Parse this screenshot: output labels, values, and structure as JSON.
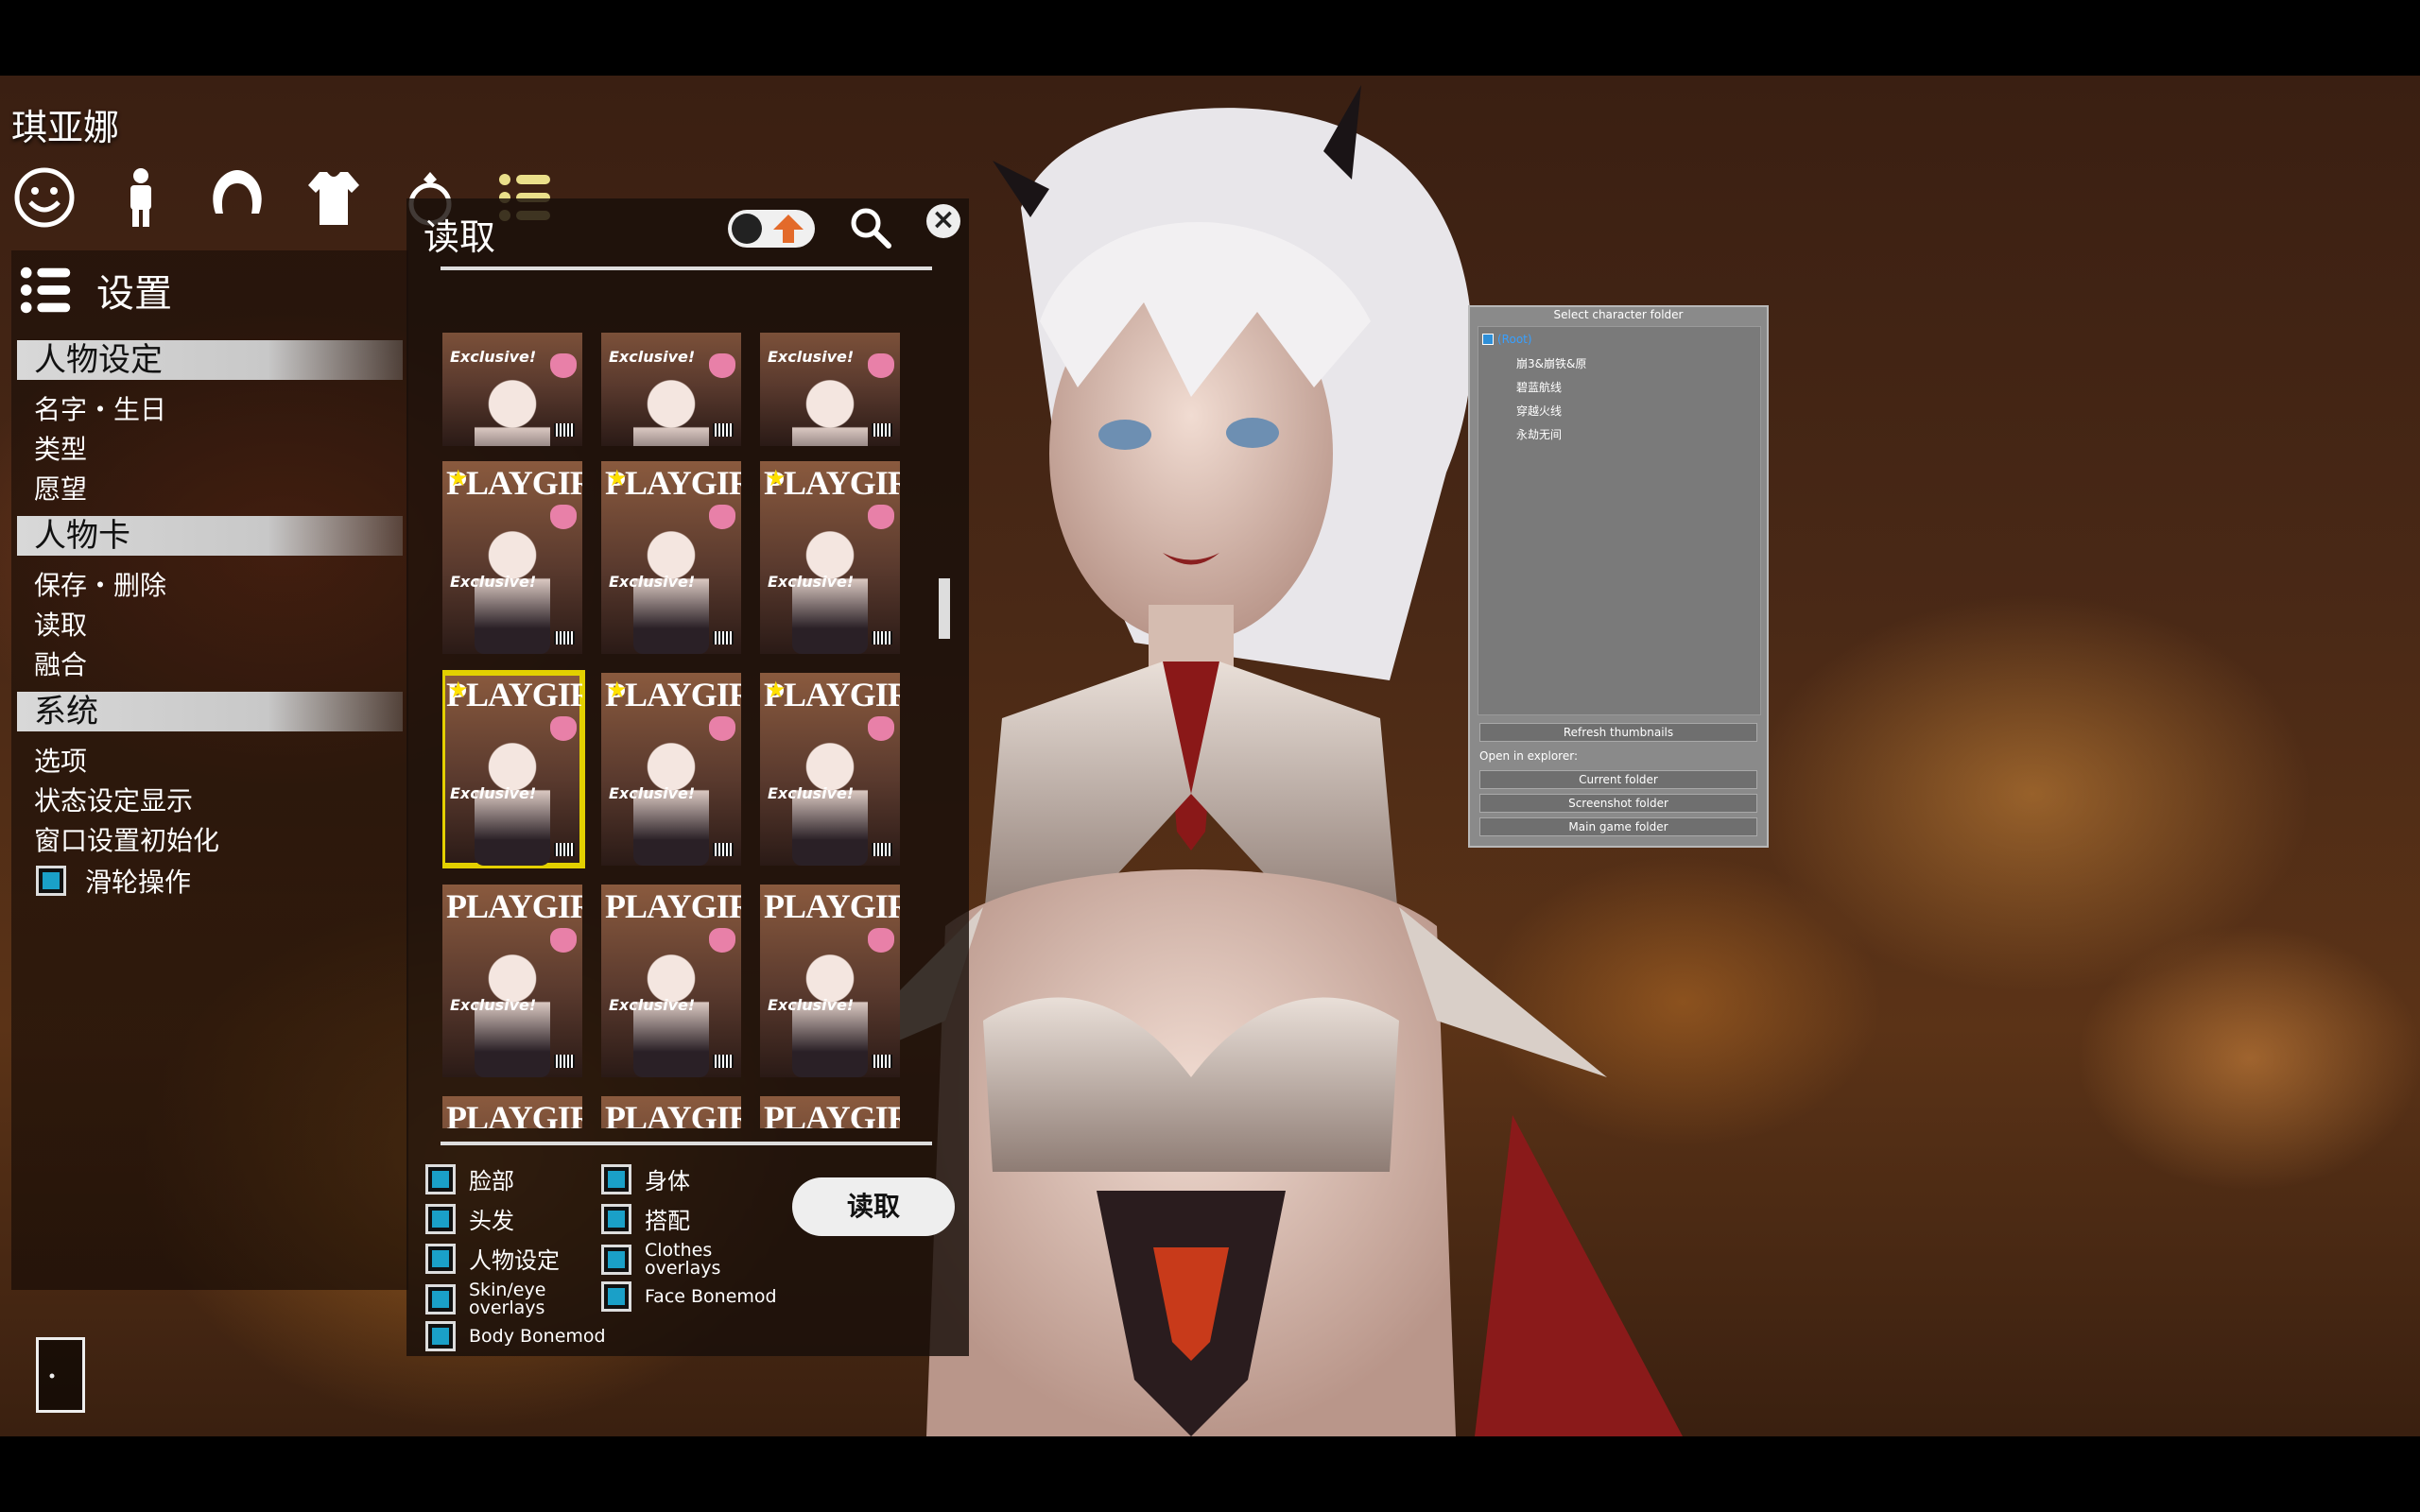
{
  "character_name": "琪亚娜",
  "tabs": [
    {
      "name": "face-icon"
    },
    {
      "name": "body-icon"
    },
    {
      "name": "hair-icon"
    },
    {
      "name": "clothes-icon"
    },
    {
      "name": "accessory-icon"
    },
    {
      "name": "settings-list-icon"
    }
  ],
  "settings": {
    "title": "设置",
    "sections": [
      {
        "header": "人物设定",
        "items": [
          "名字・生日",
          "类型",
          "愿望"
        ]
      },
      {
        "header": "人物卡",
        "items": [
          "保存・删除",
          "读取",
          "融合"
        ]
      },
      {
        "header": "系统",
        "items": [
          "选项",
          "状态设定显示",
          "窗口设置初始化"
        ]
      }
    ],
    "wheel_label": "滑轮操作"
  },
  "load_panel": {
    "title": "读取",
    "cards": [
      {
        "mast": "",
        "tag": "Exclusive!"
      },
      {
        "mast": "",
        "tag": "Exclusive!"
      },
      {
        "mast": "",
        "tag": "Exclusive!"
      },
      {
        "mast": "PLAYGIRL",
        "tag": "Exclusive!"
      },
      {
        "mast": "PLAYGIRL",
        "tag": "Exclusive!"
      },
      {
        "mast": "PLAYGIRL",
        "tag": "Exclusive!"
      },
      {
        "mast": "PLAYGIRL",
        "tag": "Exclusive!",
        "selected": true
      },
      {
        "mast": "PLAYGIRL",
        "tag": "Exclusive!"
      },
      {
        "mast": "PLAYGIRL",
        "tag": "Exclusive!"
      },
      {
        "mast": "PLAYGIRL",
        "tag": "Exclusive!"
      },
      {
        "mast": "PLAYGIRL",
        "tag": "Exclusive!"
      },
      {
        "mast": "PLAYGIRL",
        "tag": "Exclusive!"
      },
      {
        "mast": "PLAYGIRL",
        "tag": ""
      },
      {
        "mast": "PLAYGIRL",
        "tag": ""
      },
      {
        "mast": "PLAYGIRL",
        "tag": ""
      }
    ],
    "checks": {
      "face": "脸部",
      "body": "身体",
      "hair": "头发",
      "outfit": "搭配",
      "character": "人物设定",
      "clothes_overlays_1": "Clothes",
      "clothes_overlays_2": "overlays",
      "skin_overlays_1": "Skin/eye",
      "skin_overlays_2": "overlays",
      "face_bonemod": "Face Bonemod",
      "body_bonemod": "Body Bonemod"
    },
    "load_button": "读取"
  },
  "folder_dialog": {
    "title": "Select character folder",
    "root": "(Root)",
    "folders": [
      "崩3&崩铁&原",
      "碧蓝航线",
      "穿越火线",
      "永劫无间"
    ],
    "refresh": "Refresh thumbnails",
    "open_in_explorer": "Open in explorer:",
    "current_folder": "Current folder",
    "screenshot_folder": "Screenshot folder",
    "main_game_folder": "Main game folder"
  },
  "colors": {
    "checkbox_fill": "#1aa0c8",
    "selected_card": "#e3d000",
    "folder_root": "#38a0ff"
  }
}
